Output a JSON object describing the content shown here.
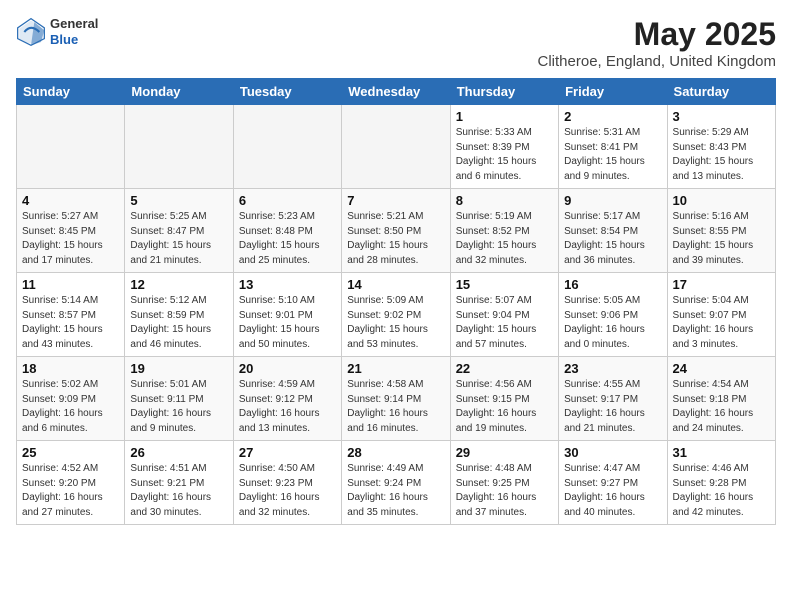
{
  "header": {
    "logo_general": "General",
    "logo_blue": "Blue",
    "month_title": "May 2025",
    "location": "Clitheroe, England, United Kingdom"
  },
  "days_of_week": [
    "Sunday",
    "Monday",
    "Tuesday",
    "Wednesday",
    "Thursday",
    "Friday",
    "Saturday"
  ],
  "weeks": [
    [
      {
        "num": "",
        "empty": true
      },
      {
        "num": "",
        "empty": true
      },
      {
        "num": "",
        "empty": true
      },
      {
        "num": "",
        "empty": true
      },
      {
        "num": "1",
        "sunrise": "5:33 AM",
        "sunset": "8:39 PM",
        "daylight": "15 hours and 6 minutes."
      },
      {
        "num": "2",
        "sunrise": "5:31 AM",
        "sunset": "8:41 PM",
        "daylight": "15 hours and 9 minutes."
      },
      {
        "num": "3",
        "sunrise": "5:29 AM",
        "sunset": "8:43 PM",
        "daylight": "15 hours and 13 minutes."
      }
    ],
    [
      {
        "num": "4",
        "sunrise": "5:27 AM",
        "sunset": "8:45 PM",
        "daylight": "15 hours and 17 minutes."
      },
      {
        "num": "5",
        "sunrise": "5:25 AM",
        "sunset": "8:47 PM",
        "daylight": "15 hours and 21 minutes."
      },
      {
        "num": "6",
        "sunrise": "5:23 AM",
        "sunset": "8:48 PM",
        "daylight": "15 hours and 25 minutes."
      },
      {
        "num": "7",
        "sunrise": "5:21 AM",
        "sunset": "8:50 PM",
        "daylight": "15 hours and 28 minutes."
      },
      {
        "num": "8",
        "sunrise": "5:19 AM",
        "sunset": "8:52 PM",
        "daylight": "15 hours and 32 minutes."
      },
      {
        "num": "9",
        "sunrise": "5:17 AM",
        "sunset": "8:54 PM",
        "daylight": "15 hours and 36 minutes."
      },
      {
        "num": "10",
        "sunrise": "5:16 AM",
        "sunset": "8:55 PM",
        "daylight": "15 hours and 39 minutes."
      }
    ],
    [
      {
        "num": "11",
        "sunrise": "5:14 AM",
        "sunset": "8:57 PM",
        "daylight": "15 hours and 43 minutes."
      },
      {
        "num": "12",
        "sunrise": "5:12 AM",
        "sunset": "8:59 PM",
        "daylight": "15 hours and 46 minutes."
      },
      {
        "num": "13",
        "sunrise": "5:10 AM",
        "sunset": "9:01 PM",
        "daylight": "15 hours and 50 minutes."
      },
      {
        "num": "14",
        "sunrise": "5:09 AM",
        "sunset": "9:02 PM",
        "daylight": "15 hours and 53 minutes."
      },
      {
        "num": "15",
        "sunrise": "5:07 AM",
        "sunset": "9:04 PM",
        "daylight": "15 hours and 57 minutes."
      },
      {
        "num": "16",
        "sunrise": "5:05 AM",
        "sunset": "9:06 PM",
        "daylight": "16 hours and 0 minutes."
      },
      {
        "num": "17",
        "sunrise": "5:04 AM",
        "sunset": "9:07 PM",
        "daylight": "16 hours and 3 minutes."
      }
    ],
    [
      {
        "num": "18",
        "sunrise": "5:02 AM",
        "sunset": "9:09 PM",
        "daylight": "16 hours and 6 minutes."
      },
      {
        "num": "19",
        "sunrise": "5:01 AM",
        "sunset": "9:11 PM",
        "daylight": "16 hours and 9 minutes."
      },
      {
        "num": "20",
        "sunrise": "4:59 AM",
        "sunset": "9:12 PM",
        "daylight": "16 hours and 13 minutes."
      },
      {
        "num": "21",
        "sunrise": "4:58 AM",
        "sunset": "9:14 PM",
        "daylight": "16 hours and 16 minutes."
      },
      {
        "num": "22",
        "sunrise": "4:56 AM",
        "sunset": "9:15 PM",
        "daylight": "16 hours and 19 minutes."
      },
      {
        "num": "23",
        "sunrise": "4:55 AM",
        "sunset": "9:17 PM",
        "daylight": "16 hours and 21 minutes."
      },
      {
        "num": "24",
        "sunrise": "4:54 AM",
        "sunset": "9:18 PM",
        "daylight": "16 hours and 24 minutes."
      }
    ],
    [
      {
        "num": "25",
        "sunrise": "4:52 AM",
        "sunset": "9:20 PM",
        "daylight": "16 hours and 27 minutes."
      },
      {
        "num": "26",
        "sunrise": "4:51 AM",
        "sunset": "9:21 PM",
        "daylight": "16 hours and 30 minutes."
      },
      {
        "num": "27",
        "sunrise": "4:50 AM",
        "sunset": "9:23 PM",
        "daylight": "16 hours and 32 minutes."
      },
      {
        "num": "28",
        "sunrise": "4:49 AM",
        "sunset": "9:24 PM",
        "daylight": "16 hours and 35 minutes."
      },
      {
        "num": "29",
        "sunrise": "4:48 AM",
        "sunset": "9:25 PM",
        "daylight": "16 hours and 37 minutes."
      },
      {
        "num": "30",
        "sunrise": "4:47 AM",
        "sunset": "9:27 PM",
        "daylight": "16 hours and 40 minutes."
      },
      {
        "num": "31",
        "sunrise": "4:46 AM",
        "sunset": "9:28 PM",
        "daylight": "16 hours and 42 minutes."
      }
    ]
  ],
  "labels": {
    "sunrise": "Sunrise:",
    "sunset": "Sunset:",
    "daylight": "Daylight:"
  }
}
